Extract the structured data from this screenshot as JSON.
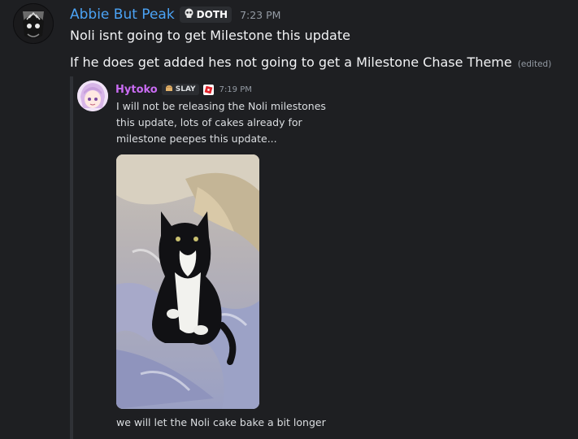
{
  "message": {
    "author": "Abbie But Peak",
    "tag": "DOTH",
    "tag_icon": "skull-icon",
    "timestamp": "7:23 PM",
    "lines": [
      "Noli isnt going to get Milestone this update",
      "If he does get added hes not going to get a Milestone Chase Theme"
    ],
    "edited_label": "(edited)"
  },
  "quoted": {
    "author": "Hytoko",
    "tag": "SLAY",
    "tag_icon": "bread-icon",
    "badge_icon": "roblox-icon",
    "timestamp": "7:19 PM",
    "text": "I will not be releasing the Noli milestones this update, lots of cakes already for milestone peepes this update...",
    "image_alt": "cat-photo",
    "caption": "we will let the Noli cake bake a bit longer"
  },
  "colors": {
    "background": "#1e1f22",
    "author_name": "#4ba3f5",
    "quoted_name": "#c96cf2",
    "muted": "#949ba4"
  }
}
